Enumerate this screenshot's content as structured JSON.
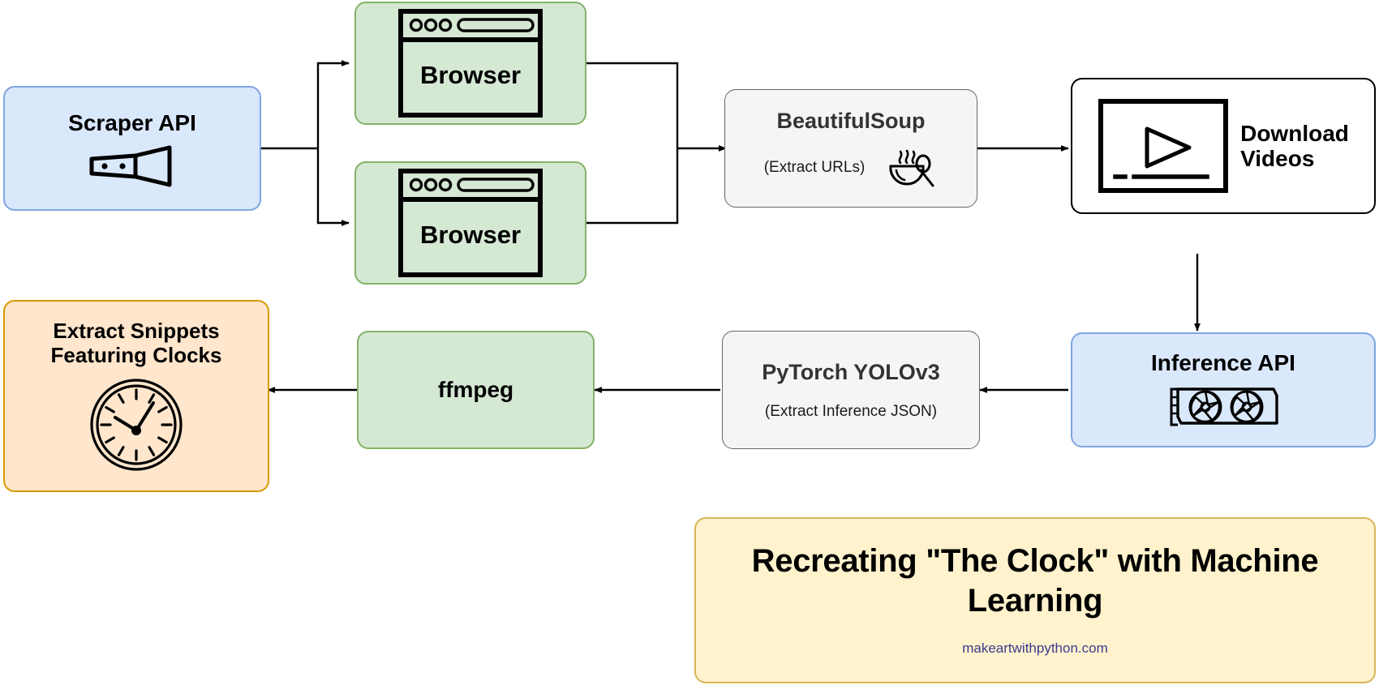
{
  "diagram": {
    "title": "Recreating \"The Clock\" with Machine Learning",
    "footer": "makeartwithpython.com",
    "nodes": {
      "scraper_api": {
        "label": "Scraper API",
        "icon": "scraper-tool-icon",
        "color": "#dae8fc"
      },
      "browser_top": {
        "label": "Browser",
        "icon": "browser-window-icon",
        "color": "#d5e8d4"
      },
      "browser_bottom": {
        "label": "Browser",
        "icon": "browser-window-icon",
        "color": "#d5e8d4"
      },
      "beautifulsoup": {
        "label": "BeautifulSoup",
        "sublabel": "(Extract URLs)",
        "icon": "soup-bowl-icon",
        "color": "#f5f5f5"
      },
      "download_videos": {
        "label_line1": "Download",
        "label_line2": "Videos",
        "icon": "video-player-icon",
        "color": "#ffffff"
      },
      "inference_api": {
        "label": "Inference API",
        "icon": "gpu-card-icon",
        "color": "#dae8fc"
      },
      "pytorch_yolo": {
        "label": "PyTorch YOLOv3",
        "sublabel": "(Extract Inference JSON)",
        "icon": "",
        "color": "#f5f5f5"
      },
      "ffmpeg": {
        "label": "ffmpeg",
        "icon": "",
        "color": "#d5e8d4"
      },
      "extract_snippets": {
        "label_line1": "Extract Snippets",
        "label_line2": "Featuring Clocks",
        "icon": "clock-icon",
        "color": "#ffe6cc"
      },
      "title_card": {
        "color": "#fff2cc"
      }
    },
    "edges": [
      {
        "from": "scraper_api",
        "to": "browser_top",
        "style": "orthogonal-arrow"
      },
      {
        "from": "scraper_api",
        "to": "browser_bottom",
        "style": "orthogonal-arrow"
      },
      {
        "from": "browser_top",
        "to": "beautifulsoup",
        "style": "orthogonal-arrow"
      },
      {
        "from": "browser_bottom",
        "to": "beautifulsoup",
        "style": "orthogonal-arrow"
      },
      {
        "from": "beautifulsoup",
        "to": "download_videos",
        "style": "straight-arrow"
      },
      {
        "from": "download_videos",
        "to": "inference_api",
        "style": "vertical-arrow"
      },
      {
        "from": "inference_api",
        "to": "pytorch_yolo",
        "style": "straight-arrow"
      },
      {
        "from": "pytorch_yolo",
        "to": "ffmpeg",
        "style": "straight-arrow"
      },
      {
        "from": "ffmpeg",
        "to": "extract_snippets",
        "style": "straight-arrow"
      }
    ]
  }
}
